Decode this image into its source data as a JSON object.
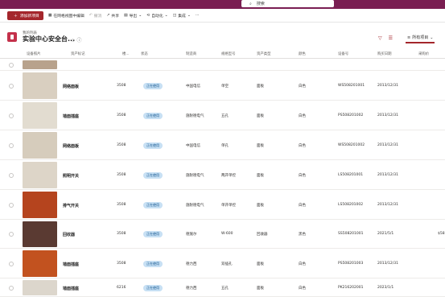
{
  "search": {
    "placeholder": "搜索"
  },
  "commands": {
    "new": "添加新项目",
    "grid": "在网格视图中编辑",
    "undo": "撤消",
    "share": "共享",
    "export": "导出",
    "automate": "自动化",
    "integrate": "集成",
    "more": "···"
  },
  "breadcrumb": "我的列表",
  "title": "实验中心安全台...",
  "view": "所有项目",
  "columns": [
    "设备照片",
    "资产标记",
    "楼...",
    "状态",
    "制造商",
    "规格型号",
    "资产类型",
    "颜色",
    "设备号",
    "购买日期",
    "采购价"
  ],
  "rows": [
    {
      "asset": "",
      "building": "",
      "status": "",
      "maker": "",
      "model": "",
      "type": "",
      "color": "",
      "code": "",
      "date": "",
      "price": "",
      "photo": "#b8a28c"
    },
    {
      "asset": "网络面板",
      "building": "3508",
      "status": "正在使用",
      "maker": "中国电信",
      "model": "单空",
      "type": "面板",
      "color": "白色",
      "code": "WS508201001",
      "date": "2013/12/31",
      "price": "",
      "photo": "#d9cfc0"
    },
    {
      "asset": "墙面插座",
      "building": "3508",
      "status": "正在使用",
      "maker": "施耐德电气",
      "model": "五孔",
      "type": "面板",
      "color": "白色",
      "code": "PS508201002",
      "date": "2013/12/31",
      "price": "",
      "photo": "#e2dcd0"
    },
    {
      "asset": "网络面板",
      "building": "3508",
      "status": "正在使用",
      "maker": "中国电信",
      "model": "单孔",
      "type": "面板",
      "color": "白色",
      "code": "WS508201002",
      "date": "2013/12/31",
      "price": "",
      "photo": "#d6ccbc"
    },
    {
      "asset": "照明开关",
      "building": "3508",
      "status": "正在使用",
      "maker": "施耐德电气",
      "model": "两开单控",
      "type": "面板",
      "color": "白色",
      "code": "LS508201001",
      "date": "2013/12/31",
      "price": "",
      "photo": "#ddd5c8"
    },
    {
      "asset": "排气开关",
      "building": "3508",
      "status": "正在使用",
      "maker": "施耐德电气",
      "model": "单开单控",
      "type": "面板",
      "color": "白色",
      "code": "LS508201002",
      "date": "2013/12/31",
      "price": "",
      "photo": "#b5441e"
    },
    {
      "asset": "回收器",
      "building": "3508",
      "status": "正在使用",
      "maker": "德施尔",
      "model": "W-600",
      "type": "回收器",
      "color": "黑色",
      "code": "SS508201001",
      "date": "2021/5/1",
      "price": "$58",
      "photo": "#5a3a32"
    },
    {
      "asset": "墙面插座",
      "building": "3508",
      "status": "正在使用",
      "maker": "德力西",
      "model": "双插孔",
      "type": "面板",
      "color": "白色",
      "code": "PS508201003",
      "date": "2013/12/31",
      "price": "",
      "photo": "#c2521f"
    },
    {
      "asset": "墙面插座",
      "building": "6216",
      "status": "正在使用",
      "maker": "德力西",
      "model": "五孔",
      "type": "面板",
      "color": "白色",
      "code": "PK216202001",
      "date": "2023/1/1",
      "price": "",
      "photo": "#dcd6cc"
    }
  ]
}
